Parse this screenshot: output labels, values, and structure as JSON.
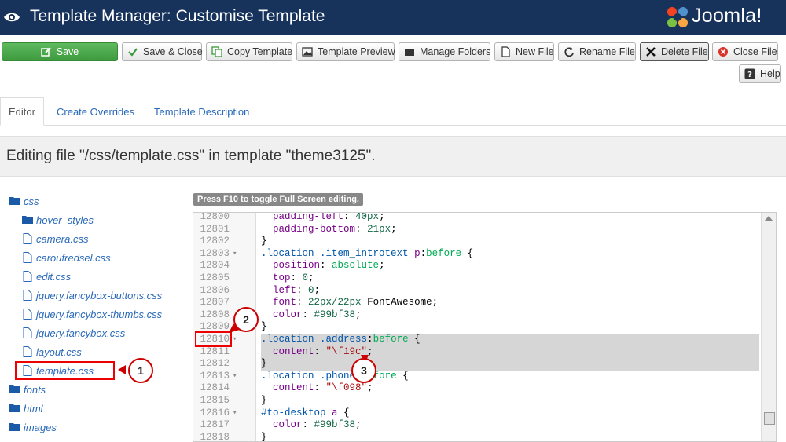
{
  "header": {
    "title": "Template Manager: Customise Template",
    "logo_text": "Joomla!"
  },
  "toolbar": {
    "save": "Save",
    "save_close": "Save & Close",
    "copy_template": "Copy Template",
    "template_preview": "Template Preview",
    "manage_folders": "Manage Folders",
    "new_file": "New File",
    "rename_file": "Rename File",
    "delete_file": "Delete File",
    "close_file": "Close File",
    "help": "Help"
  },
  "tabs": [
    "Editor",
    "Create Overrides",
    "Template Description"
  ],
  "editing_text": "Editing file \"/css/template.css\" in template \"theme3125\".",
  "file_tree": {
    "css": "css",
    "hover_styles": "hover_styles",
    "files": [
      "camera.css",
      "caroufredsel.css",
      "edit.css",
      "jquery.fancybox-buttons.css",
      "jquery.fancybox-thumbs.css",
      "jquery.fancybox.css",
      "layout.css",
      "template.css"
    ],
    "fonts": "fonts",
    "html": "html",
    "images": "images"
  },
  "editor_hint": "Press F10 to toggle Full Screen editing.",
  "code_lines": [
    {
      "num": "12800",
      "fold": "",
      "html": "  <span class=\"k\">padding-left</span>: <span class=\"n\">40px</span>;"
    },
    {
      "num": "12801",
      "fold": "",
      "html": "  <span class=\"k\">padding-bottom</span>: <span class=\"n\">21px</span>;"
    },
    {
      "num": "12802",
      "fold": "",
      "html": "}"
    },
    {
      "num": "12803",
      "fold": "▾",
      "html": "<span class=\"c\">.location</span> <span class=\"c\">.item_introtext</span> <span class=\"k\">p</span>:<span class=\"a\">before</span> {"
    },
    {
      "num": "12804",
      "fold": "",
      "html": "  <span class=\"k\">position</span>: <span class=\"a\">absolute</span>;"
    },
    {
      "num": "12805",
      "fold": "",
      "html": "  <span class=\"k\">top</span>: <span class=\"n\">0</span>;"
    },
    {
      "num": "12806",
      "fold": "",
      "html": "  <span class=\"k\">left</span>: <span class=\"n\">0</span>;"
    },
    {
      "num": "12807",
      "fold": "",
      "html": "  <span class=\"k\">font</span>: <span class=\"n\">22px/22px</span> FontAwesome;"
    },
    {
      "num": "12808",
      "fold": "",
      "html": "  <span class=\"k\">color</span>: <span class=\"n\">#99bf38</span>;"
    },
    {
      "num": "12809",
      "fold": "",
      "html": "}"
    },
    {
      "num": "12810",
      "fold": "▾",
      "hl": true,
      "html": "<span class=\"c\">.location</span> <span class=\"c\">.address</span>:<span class=\"a\">before</span> {"
    },
    {
      "num": "12811",
      "fold": "",
      "hl": true,
      "html": "  <span class=\"k\">content</span>: <span class=\"s\">\"\\f19c\"</span>;"
    },
    {
      "num": "12812",
      "fold": "",
      "hl": true,
      "html": "}"
    },
    {
      "num": "12813",
      "fold": "▾",
      "html": "<span class=\"c\">.location</span> <span class=\"c\">.phone</span>:<span class=\"a\">before</span> {"
    },
    {
      "num": "12814",
      "fold": "",
      "html": "  <span class=\"k\">content</span>: <span class=\"s\">\"\\f098\"</span>;"
    },
    {
      "num": "12815",
      "fold": "",
      "html": "}"
    },
    {
      "num": "12816",
      "fold": "▾",
      "html": "<span class=\"c\">#to-desktop</span> <span class=\"k\">a</span> {"
    },
    {
      "num": "12817",
      "fold": "",
      "html": "  <span class=\"k\">color</span>: <span class=\"n\">#99bf38</span>;"
    },
    {
      "num": "12818",
      "fold": "",
      "html": "}"
    }
  ],
  "callouts": [
    "1",
    "2",
    "3"
  ],
  "colors": {
    "header_bg": "#17335c",
    "save_green": "#4cab4c",
    "link_blue": "#2a69b8",
    "callout_red": "#e00000"
  }
}
